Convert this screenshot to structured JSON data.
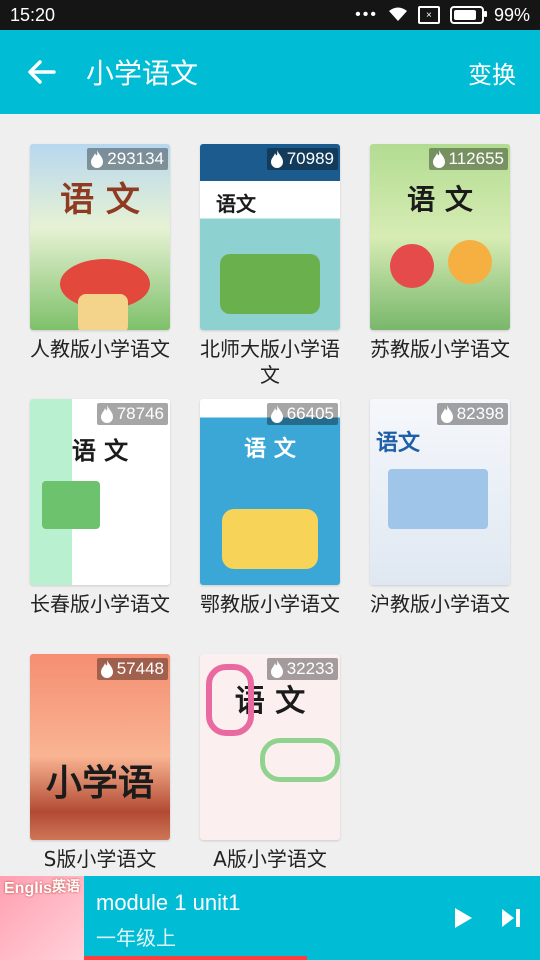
{
  "status": {
    "time": "15:20",
    "battery": "99%"
  },
  "header": {
    "back_icon": "arrow-left-icon",
    "title": "小学语文",
    "action": "变换"
  },
  "books": [
    {
      "label": "人教版小学语文",
      "count": "293134"
    },
    {
      "label": "北师大版小学语文",
      "count": "70989"
    },
    {
      "label": "苏教版小学语文",
      "count": "112655"
    },
    {
      "label": "长春版小学语文",
      "count": "78746"
    },
    {
      "label": "鄂教版小学语文",
      "count": "66405"
    },
    {
      "label": "沪教版小学语文",
      "count": "82398"
    },
    {
      "label": "S版小学语文",
      "count": "57448"
    },
    {
      "label": "A版小学语文",
      "count": "32233"
    }
  ],
  "player": {
    "title": "module 1 unit1",
    "subtitle": "一年级上",
    "thumb_en": "English",
    "thumb_cn": "英语",
    "play_icon": "play-icon",
    "next_icon": "skip-next-icon",
    "progress": 0.49
  },
  "colors": {
    "primary": "#00bcd4",
    "progress": "#ff3d3d"
  }
}
